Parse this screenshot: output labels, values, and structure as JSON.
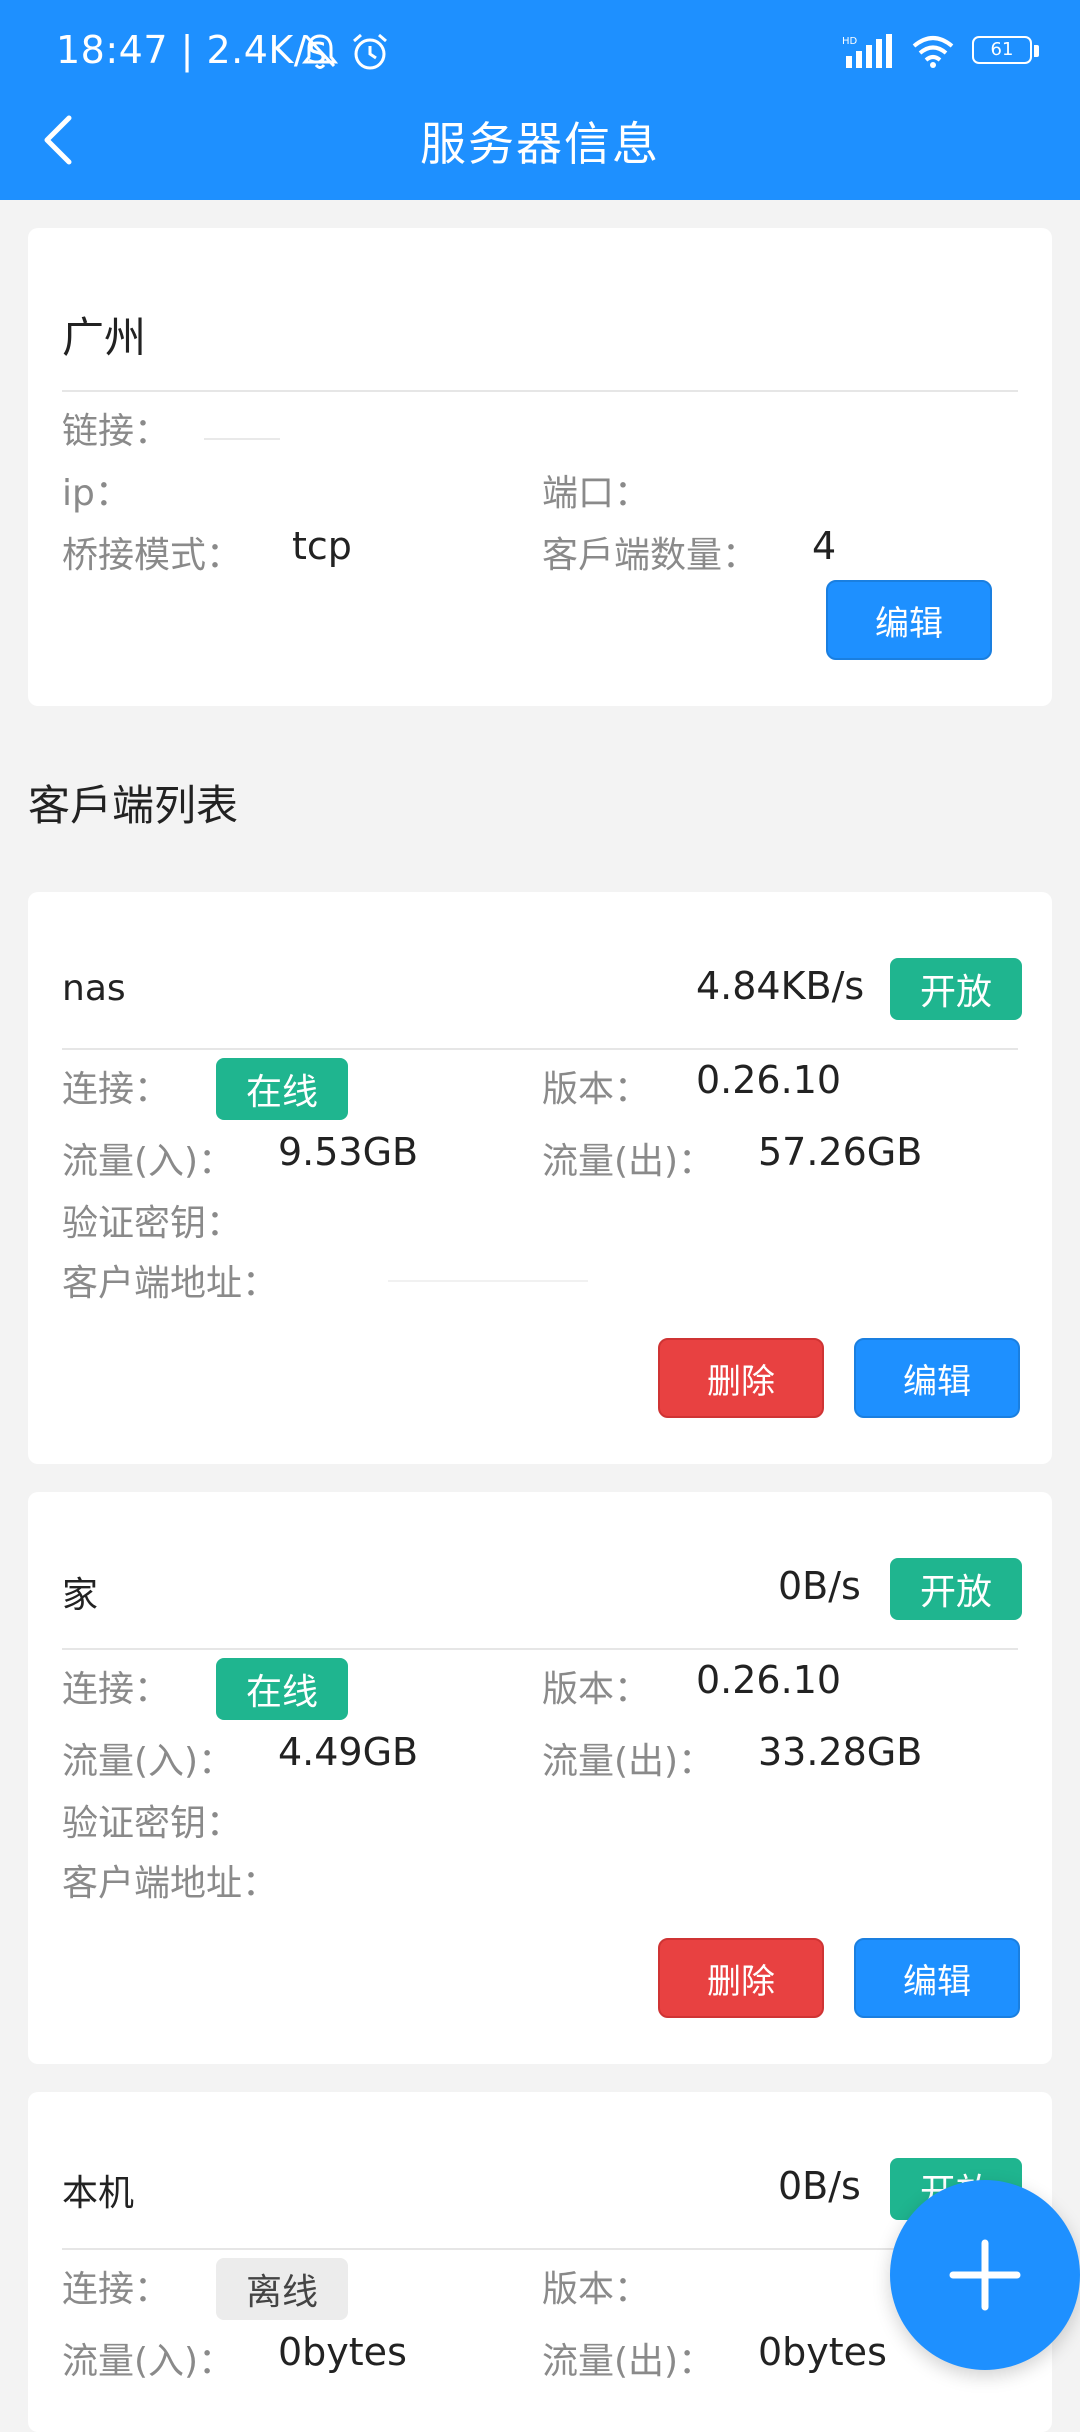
{
  "status_bar": {
    "time": "18:47 | 2.4K/s",
    "battery": "61"
  },
  "header": {
    "title": "服务器信息"
  },
  "server": {
    "name": "广州",
    "link_label": "链接：",
    "ip_label": "ip：",
    "port_label": "端口：",
    "mode_label": "桥接模式：",
    "mode_value": "tcp",
    "client_count_label": "客戶端数量：",
    "client_count_value": "4",
    "edit_label": "编辑"
  },
  "client_list_title": "客戶端列表",
  "labels": {
    "connection": "连接：",
    "version": "版本：",
    "traffic_in": "流量(入)：",
    "traffic_out": "流量(出)：",
    "key": "验证密钥：",
    "address": "客户端地址：",
    "delete": "删除",
    "edit": "编辑"
  },
  "clients": [
    {
      "name": "nas",
      "speed": "4.84KB/s",
      "access": "开放",
      "status": "在线",
      "version": "0.26.10",
      "traffic_in": "9.53GB",
      "traffic_out": "57.26GB"
    },
    {
      "name": "家",
      "speed": "0B/s",
      "access": "开放",
      "status": "在线",
      "version": "0.26.10",
      "traffic_in": "4.49GB",
      "traffic_out": "33.28GB"
    },
    {
      "name": "本机",
      "speed": "0B/s",
      "access": "开放",
      "status": "离线",
      "version": "",
      "traffic_in": "0bytes",
      "traffic_out": "0bytes"
    }
  ],
  "colors": {
    "primary": "#1e90ff",
    "danger": "#e84141",
    "success": "#1fb58f"
  }
}
